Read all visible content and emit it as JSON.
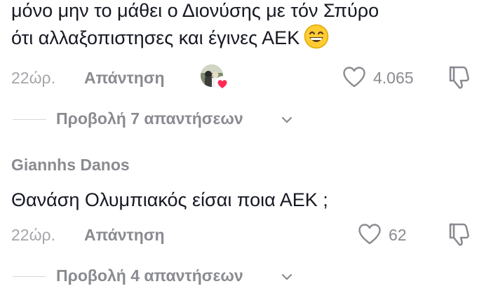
{
  "comment1": {
    "line1": "μόνο μην το μάθει ο Διονύσης με τόν Σπύρο",
    "line2": "ότι αλλαξοπιστησες και έγινες ΑΕΚ",
    "emoji": "grinning-face-with-smiling-eyes",
    "time": "22ώρ.",
    "reply_label": "Απάντηση",
    "likes": "4.065",
    "view_replies": "Προβολή 7 απαντήσεων"
  },
  "comment2": {
    "username": "Giannhs Danos",
    "text": "Θανάση Ολυμπιακός είσαι ποια ΑΕΚ ;",
    "time": "22ώρ.",
    "reply_label": "Απάντηση",
    "likes": "62",
    "view_replies": "Προβολή 4 απαντήσεων"
  },
  "colors": {
    "text": "#161823",
    "muted": "#8a8b91",
    "time": "#a5a5aa",
    "heart_badge": "#fe2c55",
    "divider": "#d8d8dc"
  }
}
